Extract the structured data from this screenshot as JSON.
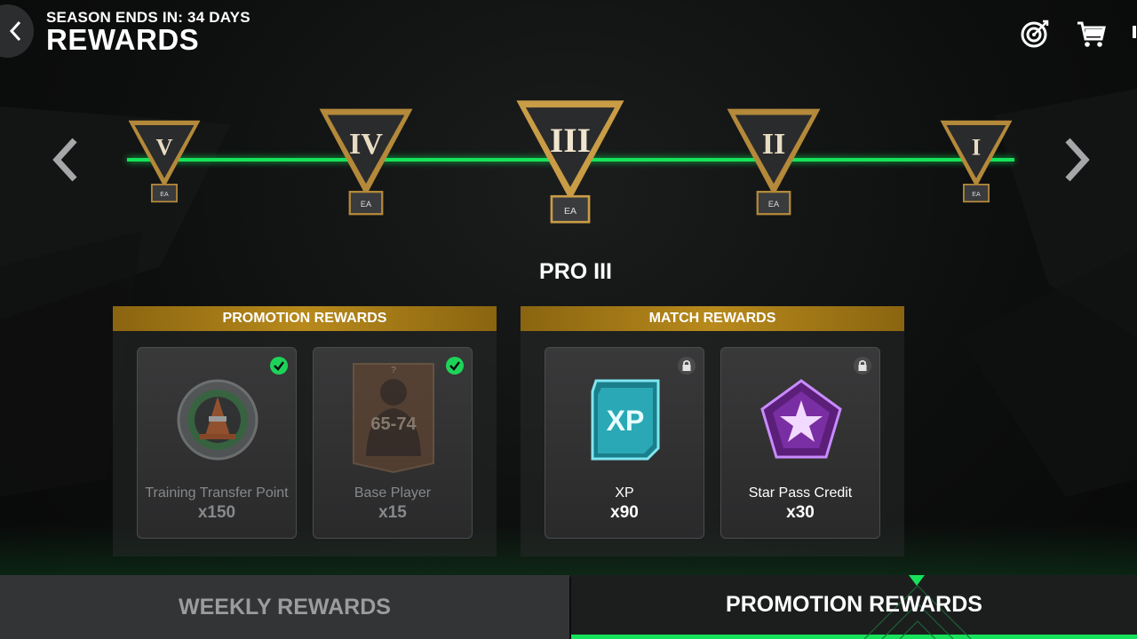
{
  "header": {
    "season_text": "SEASON ENDS IN: 34 DAYS",
    "title": "REWARDS"
  },
  "divisions": {
    "items": [
      {
        "numeral": "V"
      },
      {
        "numeral": "IV"
      },
      {
        "numeral": "III",
        "selected": true
      },
      {
        "numeral": "II"
      },
      {
        "numeral": "I"
      }
    ],
    "selected_name": "PRO III"
  },
  "promotion_rewards": {
    "title": "PROMOTION REWARDS",
    "cards": [
      {
        "name": "Training Transfer Point",
        "qty": "x150",
        "status": "claimed",
        "icon": "training-transfer-point-icon"
      },
      {
        "name": "Base Player",
        "qty": "x15",
        "status": "claimed",
        "icon": "player-card-icon",
        "rating_range": "65-74"
      }
    ]
  },
  "match_rewards": {
    "title": "MATCH REWARDS",
    "cards": [
      {
        "name": "XP",
        "qty": "x90",
        "status": "locked",
        "icon": "xp-icon",
        "icon_text": "XP"
      },
      {
        "name": "Star Pass Credit",
        "qty": "x30",
        "status": "locked",
        "icon": "star-pass-credit-icon"
      }
    ]
  },
  "tabs": [
    {
      "label": "WEEKLY REWARDS",
      "active": false
    },
    {
      "label": "PROMOTION REWARDS",
      "active": true
    }
  ],
  "colors": {
    "accent_green": "#16e25a",
    "gold_header": "#b88a1c",
    "claimed_check": "#1ed35a"
  }
}
